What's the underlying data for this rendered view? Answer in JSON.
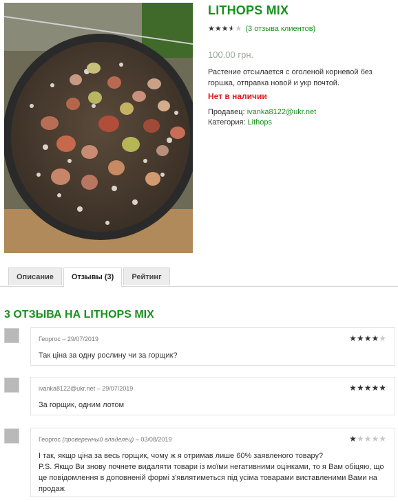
{
  "product": {
    "title": "LITHOPS MIX",
    "rating": 3.5,
    "reviews_link": "(3 отзыва клиентов)",
    "price": "100.00 грн.",
    "description": "Растение отсылается с оголеной корневой без горшка, отправка новой и укр почтой.",
    "stock_status": "Нет в наличии",
    "seller_label": "Продавец:",
    "seller": "ivanka8122@ukr.net",
    "category_label": "Категория:",
    "category": "Lithops"
  },
  "tabs": [
    {
      "label": "Описание",
      "active": false
    },
    {
      "label": "Отзывы (3)",
      "active": true
    },
    {
      "label": "Рейтинг",
      "active": false
    }
  ],
  "reviews_heading": "3 ОТЗЫВА НА LITHOPS MIX",
  "reviews": [
    {
      "author": "Георгос",
      "verified": "",
      "date": "29/07/2019",
      "rating": 4,
      "text": "Так ціна за одну рослину чи за горщик?"
    },
    {
      "author": "ivanka8122@ukr.net",
      "verified": "",
      "date": "29/07/2019",
      "rating": 5,
      "text": "За горщик, одним лотом"
    },
    {
      "author": "Георгос",
      "verified": "(проверенный владелец)",
      "date": "03/08/2019",
      "rating": 1,
      "text": "І так, якщо ціна за весь горщик, чому ж я отримав лише 60% заявленого товару?\nP.S. Якщо Ви знову почнете видаляти товари із моїми негативними оцінками, то я Вам обіцяю, що це повідомлення в доповненій формі з'являтиметься під усіма товарами виставленими Вами на продаж"
    }
  ],
  "colors": {
    "accent_green": "#17911d",
    "out_of_stock": "#e01b1b",
    "price_gray": "#9aa89a"
  }
}
